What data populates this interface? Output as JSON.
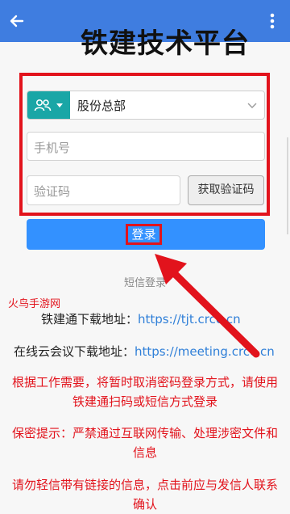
{
  "header": {
    "back_icon": "arrow-left-icon",
    "menu_icon": "more-vertical-icon",
    "title_fragment": "铁建技术平台"
  },
  "form": {
    "org_select_value": "股份总部",
    "phone_placeholder": "手机号",
    "code_placeholder": "验证码",
    "get_code_label": "获取验证码",
    "login_label": "登录"
  },
  "links": {
    "sms_login": "短信登录"
  },
  "watermark": "火鸟手游网",
  "downloads": {
    "railway_label": "铁建通下载地址：",
    "railway_url": "https://tjt.crcc.cn",
    "meeting_label": "在线云会议下载地址：",
    "meeting_url": "https://meeting.crcc.cn"
  },
  "notices": [
    "根据工作需要，将暂时取消密码登录方式，请使用铁建通扫码或短信方式登录",
    "保密提示：严禁通过互联网传输、处理涉密文件和信息",
    "请勿轻信带有链接的信息，点击前应与发信人联系确认"
  ],
  "colors": {
    "header_bg": "#3f7de0",
    "primary": "#3391ff",
    "teal": "#1aa6a6",
    "alert_red": "#e2131c",
    "link_blue": "#2f7fd8"
  }
}
